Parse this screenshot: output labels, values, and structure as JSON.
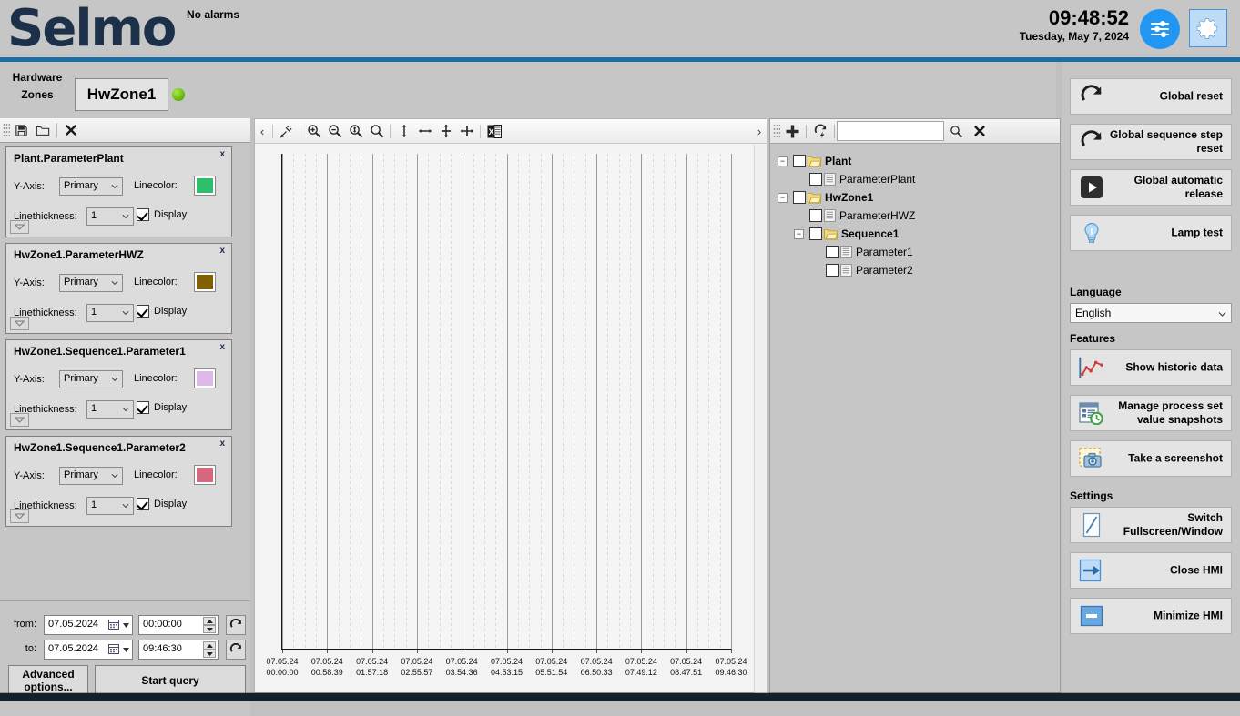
{
  "header": {
    "logo": "Selmo",
    "alarm_status": "No alarms",
    "time": "09:48:52",
    "date": "Tuesday, May 7, 2024",
    "sliders_icon": "sliders-icon",
    "gear_icon": "gear-icon",
    "accent_blue": "#2196f3",
    "brand_navy": "#1c3049",
    "bar_blue": "#1c6ea4"
  },
  "zonebar": {
    "hardware_label_line1": "Hardware",
    "hardware_label_line2": "Zones",
    "tab_label": "HwZone1",
    "led_color": "#6fc010",
    "led_name": "status-led-green"
  },
  "left_toolbar": {
    "icons": [
      {
        "name": "save-icon",
        "glyph": "save"
      },
      {
        "name": "open-folder-icon",
        "glyph": "folder"
      },
      {
        "name": "close-icon",
        "glyph": "x"
      }
    ]
  },
  "series_panels": [
    {
      "title": "Plant.ParameterPlant",
      "close_label": "x",
      "yaxis_label": "Y-Axis:",
      "yaxis_value": "Primary",
      "linecolor_label": "Linecolor:",
      "linecolor": "#2dbe6c",
      "linethickness_label": "Linethickness:",
      "linethickness_value": "1",
      "display_label": "Display",
      "display_checked": true
    },
    {
      "title": "HwZone1.ParameterHWZ",
      "close_label": "x",
      "yaxis_label": "Y-Axis:",
      "yaxis_value": "Primary",
      "linecolor_label": "Linecolor:",
      "linecolor": "#806000",
      "linethickness_label": "Linethickness:",
      "linethickness_value": "1",
      "display_label": "Display",
      "display_checked": true
    },
    {
      "title": "HwZone1.Sequence1.Parameter1",
      "close_label": "x",
      "yaxis_label": "Y-Axis:",
      "yaxis_value": "Primary",
      "linecolor_label": "Linecolor:",
      "linecolor": "#ddb9ea",
      "linethickness_label": "Linethickness:",
      "linethickness_value": "1",
      "display_label": "Display",
      "display_checked": true
    },
    {
      "title": "HwZone1.Sequence1.Parameter2",
      "close_label": "x",
      "yaxis_label": "Y-Axis:",
      "yaxis_value": "Primary",
      "linecolor_label": "Linecolor:",
      "linecolor": "#d4697e",
      "linethickness_label": "Linethickness:",
      "linethickness_value": "1",
      "display_label": "Display",
      "display_checked": true
    }
  ],
  "query": {
    "from_label": "from:",
    "to_label": "to:",
    "from_date": "07.05.2024",
    "from_time": "00:00:00",
    "to_date": "07.05.2024",
    "to_time": "09:46:30",
    "advanced_button": "Advanced options...",
    "start_button": "Start query",
    "refresh_icon": "refresh-icon",
    "calendar_icon": "calendar-icon"
  },
  "chart_toolbar": {
    "prev_label": "‹",
    "next_label": "›",
    "icons": [
      {
        "name": "pointer-zoom-tool-icon"
      },
      {
        "name": "zoom-in-icon"
      },
      {
        "name": "zoom-out-icon"
      },
      {
        "name": "zoom-in-vertical-icon"
      },
      {
        "name": "zoom-reset-icon"
      },
      {
        "name": "fit-vertical-icon"
      },
      {
        "name": "fit-horizontal-icon"
      },
      {
        "name": "scale-vertical-icon"
      },
      {
        "name": "scale-horizontal-icon"
      },
      {
        "name": "export-excel-icon"
      }
    ]
  },
  "chart_data": {
    "type": "line",
    "title": "",
    "xlabel": "",
    "ylabel": "",
    "grid": true,
    "legend_position": "none",
    "minor_gridlines_per_major": 3,
    "x_tick_labels": [
      "07.05.24\n00:00:00",
      "07.05.24\n00:58:39",
      "07.05.24\n01:57:18",
      "07.05.24\n02:55:57",
      "07.05.24\n03:54:36",
      "07.05.24\n04:53:15",
      "07.05.24\n05:51:54",
      "07.05.24\n06:50:33",
      "07.05.24\n07:49:12",
      "07.05.24\n08:47:51",
      "07.05.24\n09:46:30"
    ],
    "x_ticks_date": [
      "07.05.24",
      "07.05.24",
      "07.05.24",
      "07.05.24",
      "07.05.24",
      "07.05.24",
      "07.05.24",
      "07.05.24",
      "07.05.24",
      "07.05.24",
      "07.05.24"
    ],
    "x_ticks_time": [
      "00:00:00",
      "00:58:39",
      "01:57:18",
      "02:55:57",
      "03:54:36",
      "04:53:15",
      "05:51:54",
      "06:50:33",
      "07:49:12",
      "08:47:51",
      "09:46:30"
    ],
    "xlim": [
      "07.05.24 00:00:00",
      "07.05.24 09:46:30"
    ],
    "y_tick_labels": [],
    "ylim": [
      0,
      0
    ],
    "series": [
      {
        "name": "Plant.ParameterPlant",
        "color": "#2dbe6c",
        "values": []
      },
      {
        "name": "HwZone1.ParameterHWZ",
        "color": "#806000",
        "values": []
      },
      {
        "name": "HwZone1.Sequence1.Parameter1",
        "color": "#ddb9ea",
        "values": []
      },
      {
        "name": "HwZone1.Sequence1.Parameter2",
        "color": "#d4697e",
        "values": []
      }
    ],
    "note": "No data plotted - empty chart awaiting query"
  },
  "tree_toolbar": {
    "add_icon": "plus-icon",
    "refresh_icon": "refresh-lightning-icon",
    "search_value": "",
    "search_placeholder": "",
    "search_icon": "search-icon",
    "clear_icon": "clear-x-icon"
  },
  "tree": [
    {
      "label": "Plant",
      "depth": 0,
      "bold": true,
      "icon": "folder-icon",
      "expander": "-",
      "checked": false
    },
    {
      "label": "ParameterPlant",
      "depth": 1,
      "bold": false,
      "icon": "document-icon",
      "expander": "",
      "checked": false
    },
    {
      "label": "HwZone1",
      "depth": 0,
      "bold": true,
      "icon": "folder-icon",
      "expander": "-",
      "checked": false
    },
    {
      "label": "ParameterHWZ",
      "depth": 1,
      "bold": false,
      "icon": "document-icon",
      "expander": "",
      "checked": false
    },
    {
      "label": "Sequence1",
      "depth": 1,
      "bold": true,
      "icon": "folder-icon",
      "expander": "-",
      "checked": false
    },
    {
      "label": "Parameter1",
      "depth": 2,
      "bold": false,
      "icon": "document-icon",
      "expander": "",
      "checked": false
    },
    {
      "label": "Parameter2",
      "depth": 2,
      "bold": false,
      "icon": "document-icon",
      "expander": "",
      "checked": false
    }
  ],
  "sidebar": {
    "actions": [
      {
        "label": "Global reset",
        "icon": "reset-circular-arrow-icon"
      },
      {
        "label": "Global sequence step reset",
        "icon": "reset-circular-arrow-icon"
      },
      {
        "label": "Global automatic release",
        "icon": "play-button-icon"
      },
      {
        "label": "Lamp test",
        "icon": "lightbulb-icon"
      }
    ],
    "language_header": "Language",
    "language_value": "English",
    "features_header": "Features",
    "features": [
      {
        "label": "Show historic data",
        "icon": "line-chart-icon"
      },
      {
        "label": "Manage process set value snapshots",
        "icon": "document-clock-icon"
      },
      {
        "label": "Take a screenshot",
        "icon": "camera-icon"
      }
    ],
    "settings_header": "Settings",
    "settings": [
      {
        "label": "Switch Fullscreen/Window",
        "icon": "diagonal-resize-icon"
      },
      {
        "label": "Close HMI",
        "icon": "exit-arrow-icon"
      },
      {
        "label": "Minimize HMI",
        "icon": "minimize-icon"
      }
    ]
  }
}
